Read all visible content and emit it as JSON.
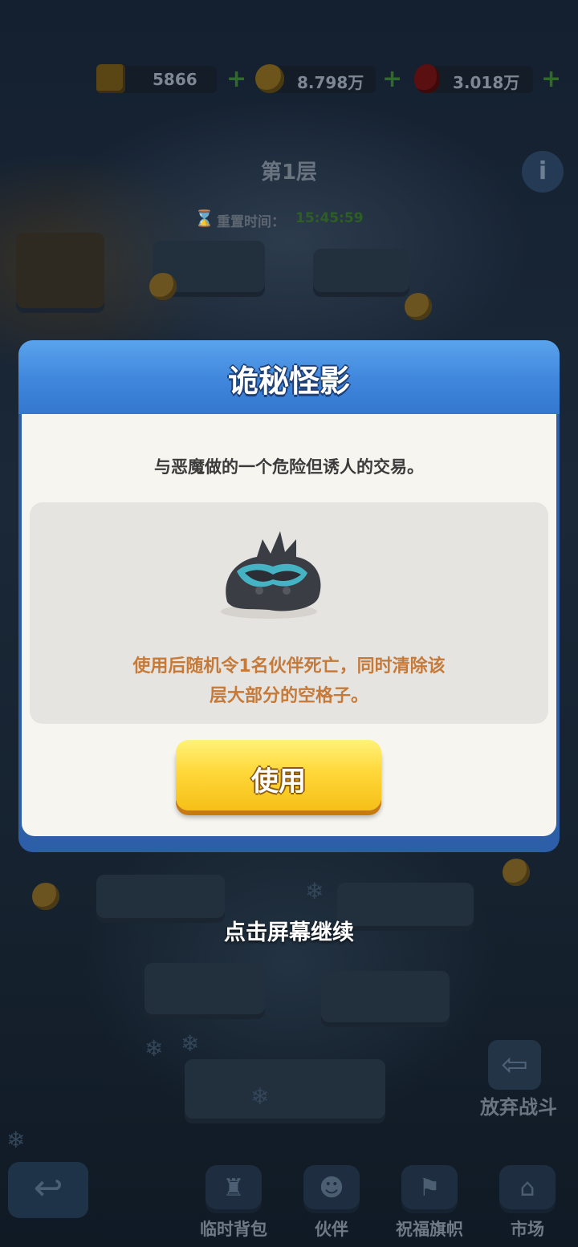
{
  "resources": {
    "blocks": {
      "value": "5866",
      "icon": "gold-block-icon"
    },
    "coins": {
      "value": "8.798万",
      "icon": "gold-coin-icon"
    },
    "gems": {
      "value": "3.018万",
      "icon": "red-gem-icon"
    },
    "plus_symbol": "+"
  },
  "floor": {
    "title": "第1层",
    "info_icon": "i",
    "reset_label": "重置时间：",
    "reset_time": "15:45:59"
  },
  "dialog": {
    "title": "诡秘怪影",
    "description": "与恶魔做的一个危险但诱人的交易。",
    "item_icon": "shadow-creature-icon",
    "effect_line1": "使用后随机令1名伙伴死亡，同时清除该",
    "effect_line2": "层大部分的空格子。",
    "use_button": "使用"
  },
  "tap_hint": "点击屏幕继续",
  "abandon_label": "放弃战斗",
  "bottom_nav": [
    {
      "label": "临时背包",
      "icon": "bag-icon"
    },
    {
      "label": "伙伴",
      "icon": "partners-icon"
    },
    {
      "label": "祝福旗帜",
      "icon": "banner-icon"
    },
    {
      "label": "市场",
      "icon": "market-icon"
    }
  ],
  "colors": {
    "dialog_header": "#3f86dc",
    "dialog_body": "#f7f5ef",
    "effect_text": "#c57a3a",
    "button_yellow": "#ffd83a"
  }
}
